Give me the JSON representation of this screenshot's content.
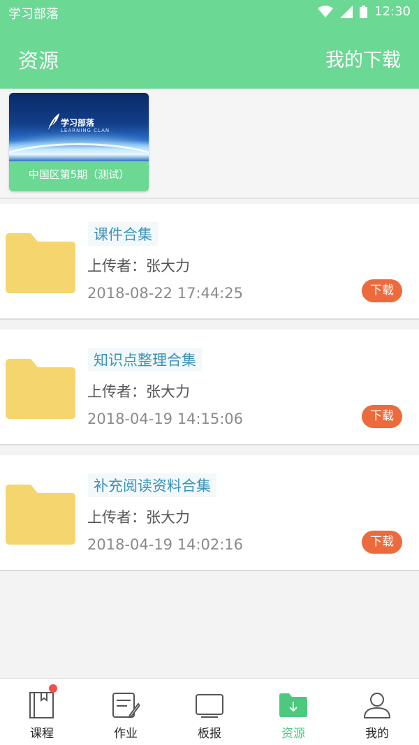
{
  "status_bar": {
    "app_name": "学习部落",
    "time": "12:30"
  },
  "app_bar": {
    "title": "资源",
    "action": "我的下载"
  },
  "course_card": {
    "logo_title": "学习部落",
    "logo_subtitle": "LEARNING CLAN",
    "label": "中国区第5期（测试）"
  },
  "resources": [
    {
      "name": "课件合集",
      "uploader": "上传者：张大力",
      "date": "2018-08-22 17:44:25",
      "download_label": "下载"
    },
    {
      "name": "知识点整理合集",
      "uploader": "上传者：张大力",
      "date": "2018-04-19 14:15:06",
      "download_label": "下载"
    },
    {
      "name": "补充阅读资料合集",
      "uploader": "上传者：张大力",
      "date": "2018-04-19 14:02:16",
      "download_label": "下载"
    }
  ],
  "tabs": [
    {
      "label": "课程",
      "icon": "book-icon",
      "badge": true
    },
    {
      "label": "作业",
      "icon": "homework-icon"
    },
    {
      "label": "板报",
      "icon": "board-icon"
    },
    {
      "label": "资源",
      "icon": "download-folder-icon",
      "active": true
    },
    {
      "label": "我的",
      "icon": "profile-icon"
    }
  ],
  "colors": {
    "primary": "#6bd894",
    "active_tab": "#4cc97f",
    "download_button": "#ec6a3c",
    "folder": "#f5d56d",
    "resource_title": "#3a93b8"
  }
}
